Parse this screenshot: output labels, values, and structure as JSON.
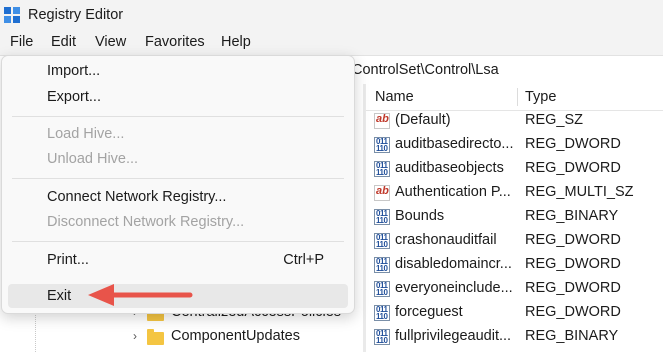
{
  "window": {
    "title": "Registry Editor",
    "icon": "registry-editor-icon"
  },
  "menubar": {
    "file": "File",
    "edit": "Edit",
    "view": "View",
    "favorites": "Favorites",
    "help": "Help"
  },
  "address": {
    "path": "ControlSet\\Control\\Lsa"
  },
  "file_menu": {
    "import": "Import...",
    "export": "Export...",
    "load_hive": "Load Hive...",
    "unload_hive": "Unload Hive...",
    "connect": "Connect Network Registry...",
    "disconnect": "Disconnect Network Registry...",
    "print": "Print...",
    "print_shortcut": "Ctrl+P",
    "exit": "Exit"
  },
  "list": {
    "col_name": "Name",
    "col_type": "Type",
    "rows": [
      {
        "name": "(Default)",
        "type": "REG_SZ",
        "icon": "string-value-icon"
      },
      {
        "name": "auditbasedirecto...",
        "type": "REG_DWORD",
        "icon": "binary-value-icon"
      },
      {
        "name": "auditbaseobjects",
        "type": "REG_DWORD",
        "icon": "binary-value-icon"
      },
      {
        "name": "Authentication P...",
        "type": "REG_MULTI_SZ",
        "icon": "string-value-icon"
      },
      {
        "name": "Bounds",
        "type": "REG_BINARY",
        "icon": "binary-value-icon"
      },
      {
        "name": "crashonauditfail",
        "type": "REG_DWORD",
        "icon": "binary-value-icon"
      },
      {
        "name": "disabledomaincr...",
        "type": "REG_DWORD",
        "icon": "binary-value-icon"
      },
      {
        "name": "everyoneinclude...",
        "type": "REG_DWORD",
        "icon": "binary-value-icon"
      },
      {
        "name": "forceguest",
        "type": "REG_DWORD",
        "icon": "binary-value-icon"
      },
      {
        "name": "fullprivilegeaudit...",
        "type": "REG_BINARY",
        "icon": "binary-value-icon"
      }
    ]
  },
  "tree": {
    "items": [
      {
        "label": "CentralizedAccessPolicies"
      },
      {
        "label": "ComponentUpdates"
      }
    ]
  },
  "colors": {
    "annotation_arrow": "#e8544a",
    "folder": "#f4c542",
    "string_icon": "#c0392b",
    "binary_icon": "#1f4e99"
  }
}
